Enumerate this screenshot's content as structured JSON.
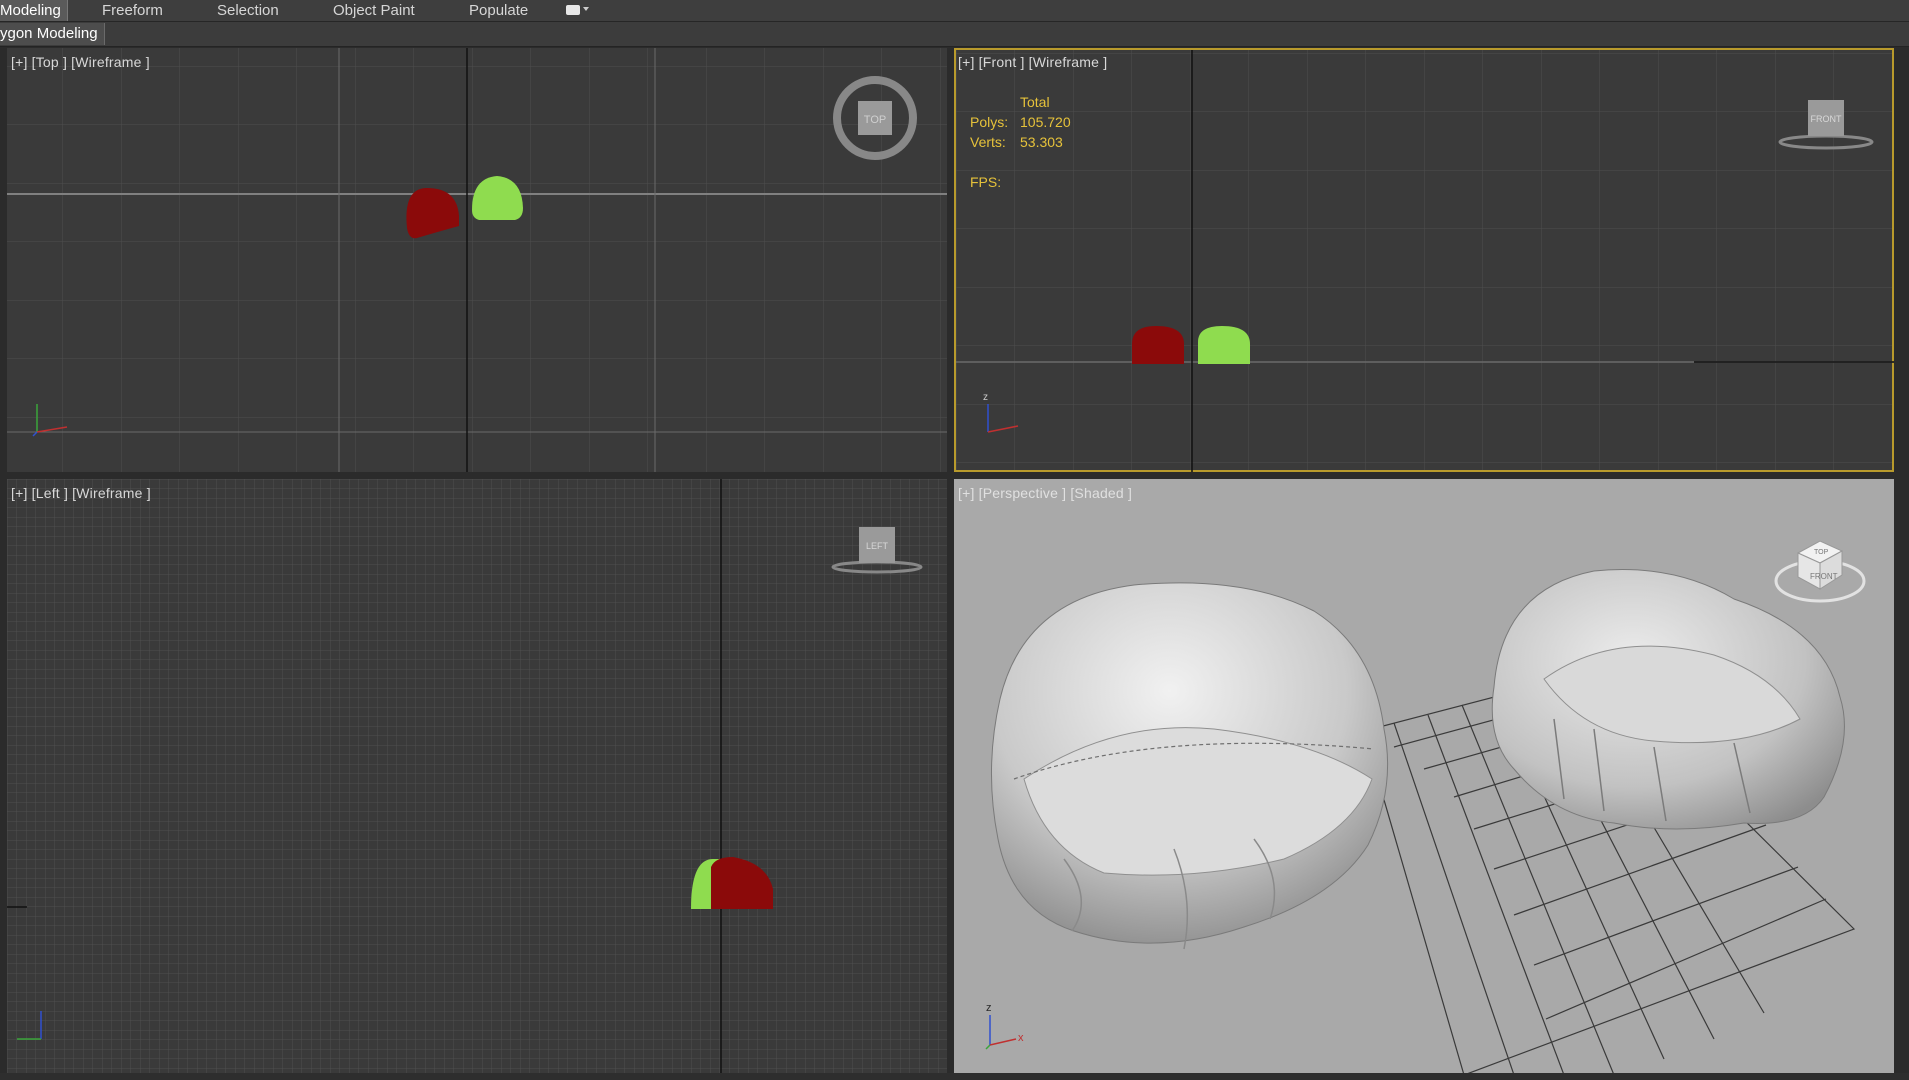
{
  "ribbon": {
    "tabs": [
      {
        "label": "Modeling",
        "active": true
      },
      {
        "label": "Freeform"
      },
      {
        "label": "Selection"
      },
      {
        "label": "Object Paint"
      },
      {
        "label": "Populate"
      }
    ],
    "dropdown_icon": "display-menu-icon",
    "sub_tab": "ygon Modeling"
  },
  "viewports": {
    "top": {
      "label": "[+] [Top ] [Wireframe ]",
      "viewcube": "TOP"
    },
    "front": {
      "label": "[+] [Front ] [Wireframe ]",
      "viewcube": "FRONT",
      "stats": {
        "header": "Total",
        "polys_label": "Polys:",
        "polys_value": "105.720",
        "verts_label": "Verts:",
        "verts_value": "53.303",
        "fps_label": "FPS:"
      }
    },
    "left": {
      "label": "[+] [Left ] [Wireframe ]",
      "viewcube": "LEFT"
    },
    "perspective": {
      "label": "[+] [Perspective ] [Shaded ]",
      "viewcube": "FRONT",
      "viewcube_top": "TOP"
    }
  },
  "colors": {
    "object_red": "#8b0a0a",
    "object_green": "#8fdc4f",
    "active_border": "#b89a2c",
    "stats_text": "#e6c23a"
  }
}
